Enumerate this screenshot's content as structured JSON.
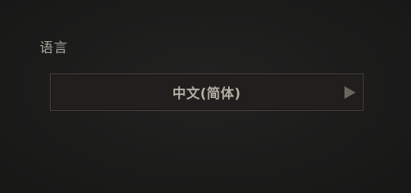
{
  "settings": {
    "language_label": "语言",
    "language_value": "中文(简体)",
    "next_icon": "triangle-right-icon"
  }
}
